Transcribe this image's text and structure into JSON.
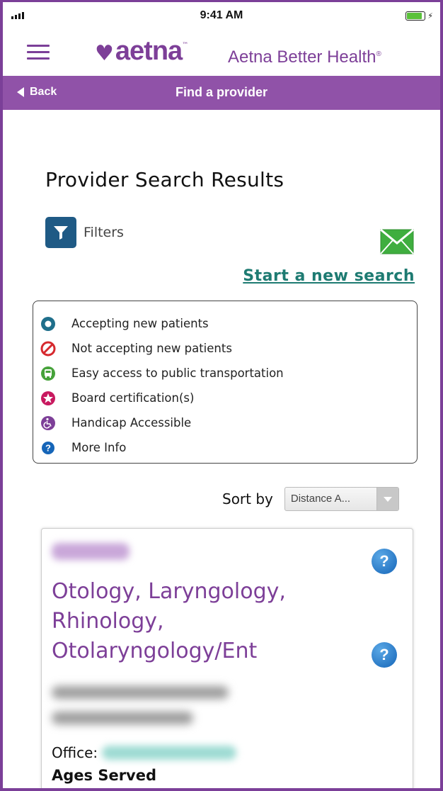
{
  "status_bar": {
    "time": "9:41 AM"
  },
  "header": {
    "logo_text": "aetna",
    "tagline": "Aetna Better Health",
    "tagline_mark": "®",
    "back_label": "Back",
    "title": "Find a provider"
  },
  "page": {
    "title": "Provider Search Results",
    "filters_label": "Filters",
    "new_search_link": "Start a new search"
  },
  "legend": {
    "items": [
      {
        "icon": "accepting-patients-icon",
        "label": "Accepting new patients",
        "color": "#1f6f8b"
      },
      {
        "icon": "not-accepting-icon",
        "label": "Not accepting new patients",
        "color": "#d6292e"
      },
      {
        "icon": "bus-icon",
        "label": "Easy access to public transportation",
        "color": "#46a23a"
      },
      {
        "icon": "star-icon",
        "label": "Board certification(s)",
        "color": "#c8195f"
      },
      {
        "icon": "wheelchair-icon",
        "label": "Handicap Accessible",
        "color": "#7d3f98"
      },
      {
        "icon": "info-icon",
        "label": "More Info",
        "color": "#1565b8"
      }
    ]
  },
  "sort": {
    "label": "Sort by",
    "selected": "Distance A..."
  },
  "provider": {
    "specialty": "Otology, Laryngology, Rhinology, Otolaryngology/Ent",
    "office_label": "Office:",
    "ages_label": "Ages Served"
  },
  "colors": {
    "brand": "#7d3f98",
    "nav_bar": "#9052a8",
    "link": "#1e7b72",
    "filter_button": "#1f5a85"
  }
}
